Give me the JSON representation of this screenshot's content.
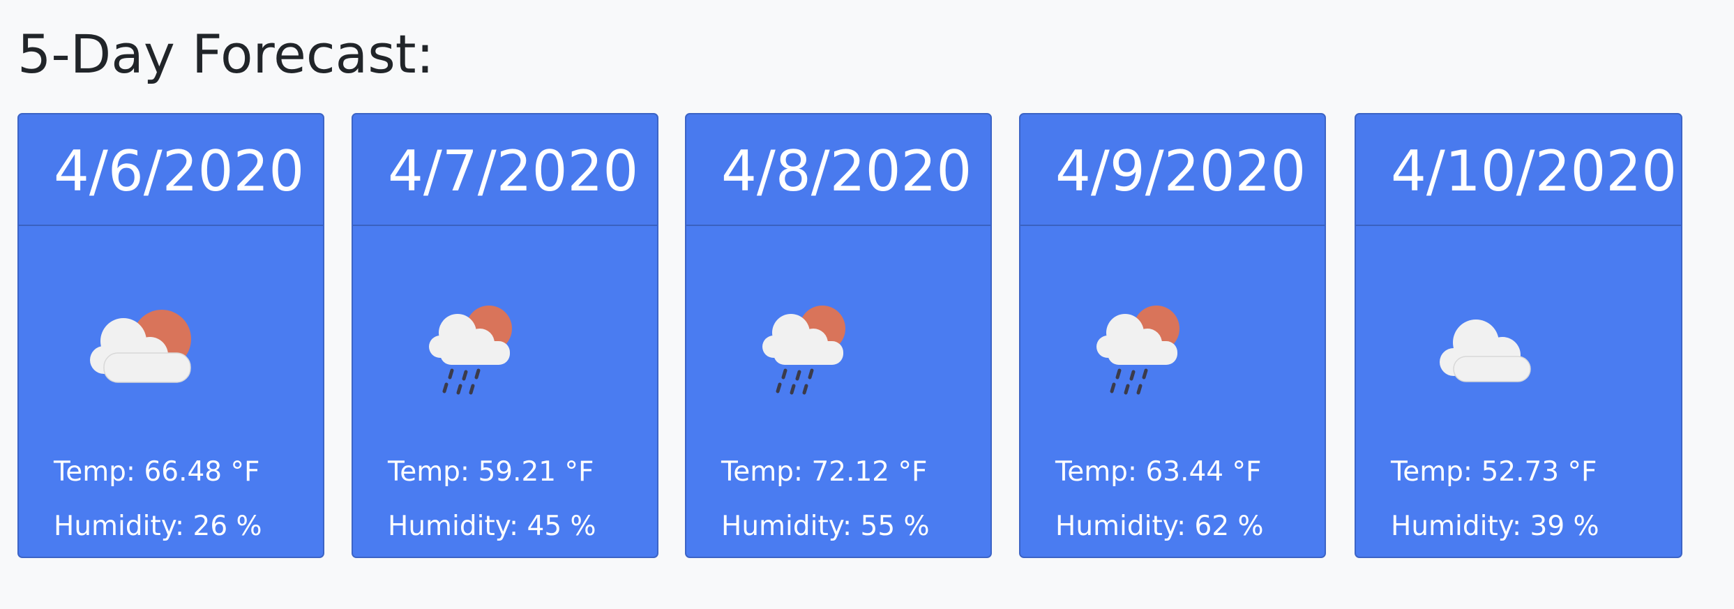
{
  "title": "5-Day Forecast:",
  "days": [
    {
      "date": "4/6/2020",
      "icon": "partly-cloudy-day-icon",
      "temp": "Temp: 66.48 °F",
      "humidity": "Humidity: 26 %"
    },
    {
      "date": "4/7/2020",
      "icon": "rain-with-sun-icon",
      "temp": "Temp: 59.21 °F",
      "humidity": "Humidity: 45 %"
    },
    {
      "date": "4/8/2020",
      "icon": "rain-with-sun-icon",
      "temp": "Temp: 72.12 °F",
      "humidity": "Humidity: 55 %"
    },
    {
      "date": "4/9/2020",
      "icon": "rain-with-sun-icon",
      "temp": "Temp: 63.44 °F",
      "humidity": "Humidity: 62 %"
    },
    {
      "date": "4/10/2020",
      "icon": "cloud-icon",
      "temp": "Temp: 52.73 °F",
      "humidity": "Humidity: 39 %"
    }
  ],
  "colors": {
    "page_background": "#f8f9fa",
    "card_background": "#4a7cf1",
    "card_border": "#3c64c6",
    "sun": "#d9745a",
    "cloud": "#f1f1f1",
    "rain": "#3b3b4a"
  }
}
